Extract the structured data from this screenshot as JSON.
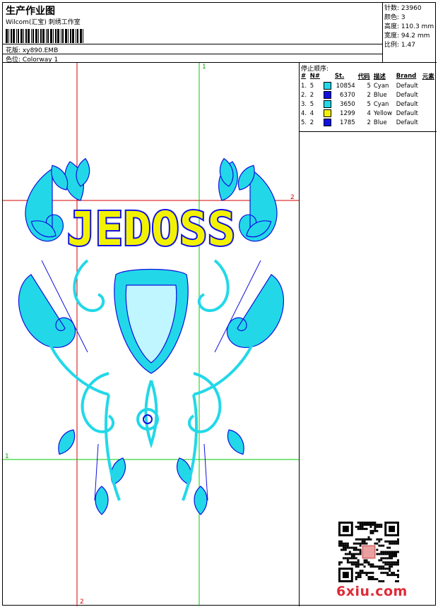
{
  "header": {
    "title": "生产作业图",
    "company": "Wilcom(汇宝) 刺绣工作室",
    "design_label": "花版:",
    "design_value": "xy890.EMB",
    "colorway_label": "色位:",
    "colorway_value": "Colorway 1"
  },
  "stats": [
    {
      "label": "针数:",
      "value": "23960"
    },
    {
      "label": "颜色:",
      "value": "3"
    },
    {
      "label": "高度:",
      "value": "110.3 mm"
    },
    {
      "label": "宽度:",
      "value": "94.2 mm"
    },
    {
      "label": "比例:",
      "value": "1.47"
    }
  ],
  "stop_sequence": {
    "title": "停止顺序:",
    "headers": [
      "#",
      "N#",
      "St.",
      "代码",
      "描述",
      "Brand",
      "元素"
    ],
    "rows": [
      {
        "idx": "1.",
        "n": "5",
        "color": "#22d8e8",
        "st": "10854",
        "code": "5",
        "desc": "Cyan",
        "brand": "Default"
      },
      {
        "idx": "2.",
        "n": "2",
        "color": "#1010e0",
        "st": "6370",
        "code": "2",
        "desc": "Blue",
        "brand": "Default"
      },
      {
        "idx": "3.",
        "n": "5",
        "color": "#22d8e8",
        "st": "3650",
        "code": "5",
        "desc": "Cyan",
        "brand": "Default"
      },
      {
        "idx": "4.",
        "n": "4",
        "color": "#f2f200",
        "st": "1299",
        "code": "4",
        "desc": "Yellow",
        "brand": "Default"
      },
      {
        "idx": "5.",
        "n": "2",
        "color": "#1010e0",
        "st": "1785",
        "code": "2",
        "desc": "Blue",
        "brand": "Default"
      }
    ]
  },
  "design_text": "JEDOSS",
  "guide_markers": {
    "top": "1",
    "right": "2",
    "left": "1",
    "bottom": "2"
  },
  "watermark": "6xiu.com",
  "colors": {
    "cyan": "#22d8e8",
    "blue": "#1010e0",
    "yellow": "#f2f200",
    "guide_red": "#d40000",
    "guide_green": "#00cc00"
  }
}
